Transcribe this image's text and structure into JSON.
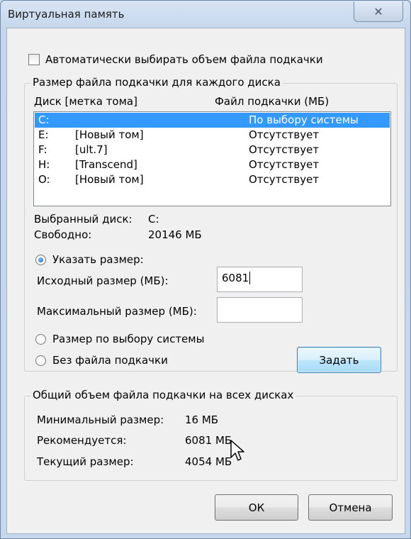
{
  "window": {
    "title": "Виртуальная память",
    "close_glyph": "✕"
  },
  "auto_checkbox": {
    "label": "Автоматически выбирать объем файла подкачки",
    "checked": false
  },
  "per_disk_group": {
    "title": "Размер файла подкачки для каждого диска",
    "col_disk": "Диск [метка тома]",
    "col_pagefile": "Файл подкачки (МБ)",
    "rows": [
      {
        "drive": "C:",
        "label": "",
        "pagefile": "По выбору системы",
        "selected": true
      },
      {
        "drive": "E:",
        "label": "[Новый том]",
        "pagefile": "Отсутствует",
        "selected": false
      },
      {
        "drive": "F:",
        "label": "[ult.7]",
        "pagefile": "Отсутствует",
        "selected": false
      },
      {
        "drive": "H:",
        "label": "[Transcend]",
        "pagefile": "Отсутствует",
        "selected": false
      },
      {
        "drive": "O:",
        "label": "[Новый том]",
        "pagefile": "Отсутствует",
        "selected": false
      }
    ],
    "selected_drive_label": "Выбранный диск:",
    "selected_drive_value": "C:",
    "free_label": "Свободно:",
    "free_value": "20146 МБ",
    "custom_size_radio": "Указать размер:",
    "initial_size_label": "Исходный размер (МБ):",
    "initial_size_value": "6081",
    "max_size_label": "Максимальный размер (МБ):",
    "max_size_value": "",
    "system_size_radio": "Размер по выбору системы",
    "no_pagefile_radio": "Без файла подкачки",
    "set_button": "Задать",
    "selected_radio": "custom"
  },
  "totals_group": {
    "title": "Общий объем файла подкачки на всех дисках",
    "min_label": "Минимальный размер:",
    "min_value": "16 МБ",
    "recommended_label": "Рекомендуется:",
    "recommended_value": "6081 МБ",
    "current_label": "Текущий размер:",
    "current_value": "4054 МБ"
  },
  "buttons": {
    "ok": "ОК",
    "cancel": "Отмена"
  },
  "colors": {
    "selection": "#3399ff",
    "title_bar": "#c5d6ec",
    "dialog_bg": "#f0f0f0"
  }
}
